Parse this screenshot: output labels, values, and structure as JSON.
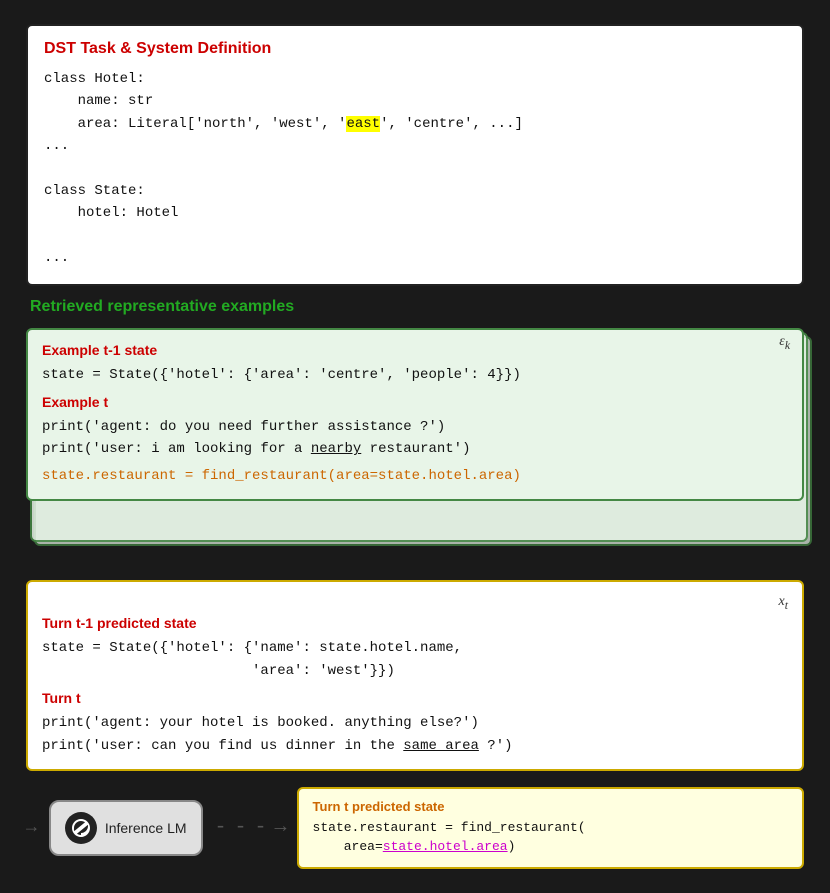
{
  "dst_box": {
    "title": "DST Task & System Definition",
    "code_lines": [
      "class Hotel:",
      "    name: str",
      "    area: Literal['north', 'west', 'east', 'centre', ...]",
      "...",
      "",
      "class State:",
      "    hotel: Hotel",
      "...",
      ""
    ],
    "highlight_word": "east"
  },
  "retrieved_label": "Retrieved representative examples",
  "example_card": {
    "ek_label": "ε_k",
    "example_t1_title": "Example t-1 state",
    "example_t1_code": "state = State({'hotel': {'area': 'centre', 'people': 4}})",
    "example_t_title": "Example t",
    "example_t_lines": [
      "print('agent: do you need further assistance ?')",
      "print('user: i am looking for a nearby restaurant')"
    ],
    "example_t_nearby": "nearby",
    "example_t_orange": "state.restaurant = find_restaurant(area=state.hotel.area)"
  },
  "turn_box": {
    "xt_label": "x_t",
    "turn_t1_title": "Turn t-1 predicted state",
    "turn_t1_code_line1": "state = State({'hotel': {'name': state.hotel.name,",
    "turn_t1_code_line2": "                         'area': 'west'}})",
    "turn_t_title": "Turn t",
    "turn_t_lines": [
      "print('agent: your hotel is booked. anything else?')",
      "print('user: can you find us dinner in the same area ?')"
    ],
    "turn_t_same_area": "same area"
  },
  "inference": {
    "lm_label": "Inference LM",
    "output_title": "Turn t predicted state",
    "output_line1": "state.restaurant = find_restaurant(",
    "output_line2": "    area=state.hotel.area",
    "output_underline": "state.hotel.area"
  }
}
